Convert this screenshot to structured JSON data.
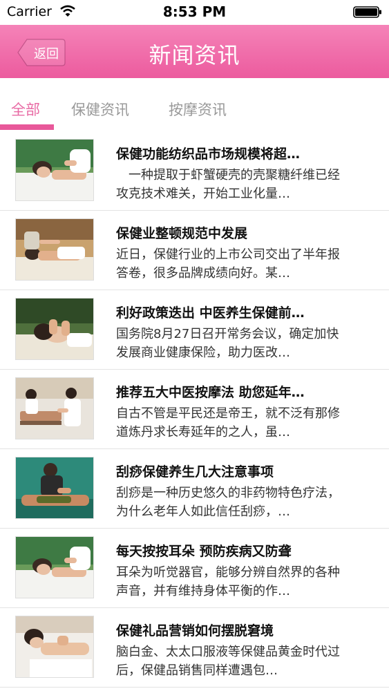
{
  "status_bar": {
    "carrier": "Carrier",
    "time": "8:53 PM"
  },
  "nav": {
    "back_label": "返回",
    "title": "新闻资讯"
  },
  "tabs": [
    {
      "label": "全部",
      "selected": true
    },
    {
      "label": "保健资讯",
      "selected": false
    },
    {
      "label": "按摩资讯",
      "selected": false
    }
  ],
  "colors": {
    "accent": "#ec5b9e",
    "tab_active": "#e86aa4"
  },
  "news": [
    {
      "title": "保健功能纺织品市场规模将超…",
      "summary": "　一种提取于虾蟹硬壳的壳聚糖纤维已经攻克技术难关，开始工业化量…",
      "image": "spa-massage-thumbnail"
    },
    {
      "title": "保健业整顿规范中发展",
      "summary": "近日，保健行业的上市公司交出了半年报答卷，很多品牌成绩向好。某…",
      "image": "spa-massage-thumbnail"
    },
    {
      "title": "利好政策迭出 中医养生保健前…",
      "summary": "国务院8月27日召开常务会议，确定加快发展商业健康保险，助力医改…",
      "image": "facial-massage-thumbnail"
    },
    {
      "title": "推荐五大中医按摩法 助您延年…",
      "summary": "自古不管是平民还是帝王，就不泛有那修道炼丹求长寿延年的之人，虽…",
      "image": "clinic-massage-thumbnail"
    },
    {
      "title": "刮痧保健养生几大注意事项",
      "summary": "刮痧是一种历史悠久的非药物特色疗法，为什么老年人如此信任刮痧，…",
      "image": "guasha-thumbnail"
    },
    {
      "title": "每天按按耳朵 预防疾病又防聋",
      "summary": "耳朵为听觉器官，能够分辨自然界的各种声音，并有维持身体平衡的作…",
      "image": "spa-massage-thumbnail"
    },
    {
      "title": "保健礼品营销如何摆脱窘境",
      "summary": " 脑白金、太太口服液等保健品黄金时代过后，保健品销售同样遭遇包…",
      "image": "back-massage-thumbnail"
    }
  ]
}
